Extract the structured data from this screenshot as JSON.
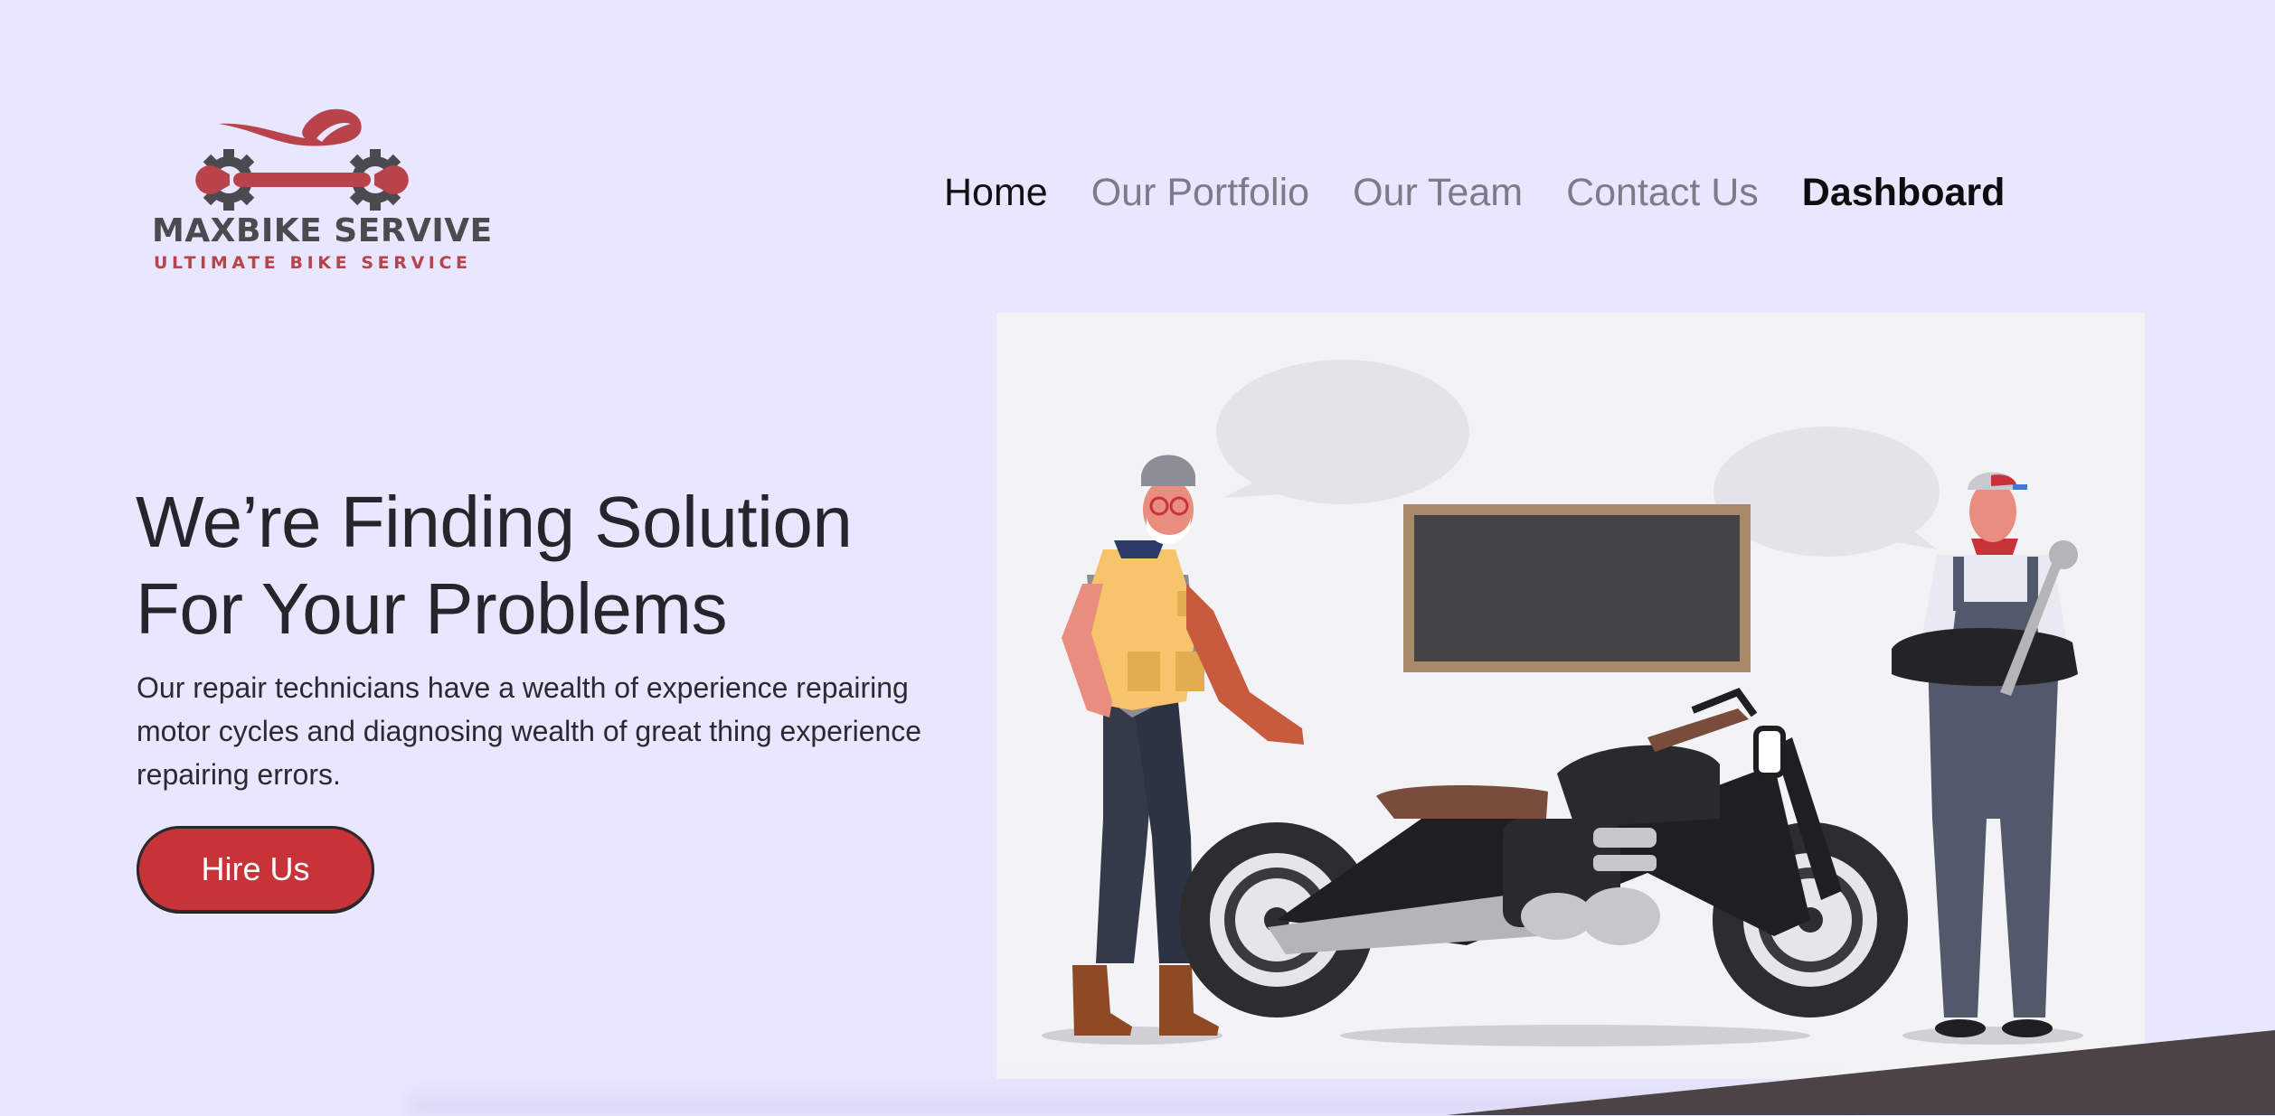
{
  "brand": {
    "name": "MAXBIKE SERVIVE",
    "tagline": "ULTIMATE BIKE SERVICE",
    "logo_icon": "motorbike-wrench-gears-icon"
  },
  "nav": {
    "items": [
      {
        "label": "Home"
      },
      {
        "label": "Our Portfolio"
      },
      {
        "label": "Our Team"
      },
      {
        "label": "Contact Us"
      },
      {
        "label": "Dashboard"
      }
    ]
  },
  "hero": {
    "title_line1": "We’re Finding Solution",
    "title_line2": "For Your Problems",
    "description": "Our repair technicians have a wealth of experience repairing motor cycles and diagnosing wealth of great thing experience repairing errors.",
    "button_label": "Hire Us"
  },
  "colors": {
    "background": "#e9e6ff",
    "accent": "#c8333a",
    "illustration_bg": "#f3f3f6",
    "corner_dark": "#4c4347"
  }
}
